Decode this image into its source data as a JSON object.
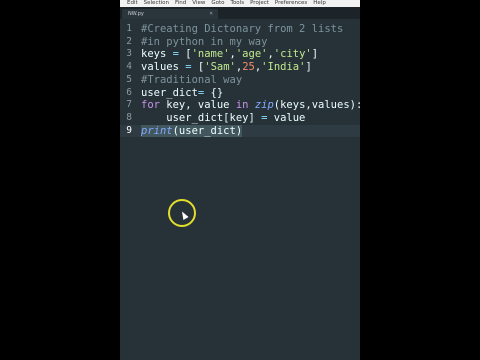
{
  "menubar": {
    "items": [
      "Edit",
      "Selection",
      "Find",
      "View",
      "Goto",
      "Tools",
      "Project",
      "Preferences",
      "Help"
    ]
  },
  "tab": {
    "label": "NW.py",
    "close": "×"
  },
  "editor": {
    "line_numbers": [
      "1",
      "2",
      "3",
      "4",
      "5",
      "6",
      "7",
      "8",
      "9"
    ],
    "lines": [
      [
        {
          "t": "#Creating Dictonary from 2 lists",
          "c": "cm"
        }
      ],
      [
        {
          "t": "#in python in my way",
          "c": "cm"
        }
      ],
      [
        {
          "t": "keys ",
          "c": ""
        },
        {
          "t": "=",
          "c": "op"
        },
        {
          "t": " [",
          "c": ""
        },
        {
          "t": "'name'",
          "c": "str"
        },
        {
          "t": ",",
          "c": ""
        },
        {
          "t": "'age'",
          "c": "str"
        },
        {
          "t": ",",
          "c": ""
        },
        {
          "t": "'city'",
          "c": "str"
        },
        {
          "t": "]",
          "c": ""
        }
      ],
      [
        {
          "t": "values ",
          "c": ""
        },
        {
          "t": "=",
          "c": "op"
        },
        {
          "t": " [",
          "c": ""
        },
        {
          "t": "'Sam'",
          "c": "str"
        },
        {
          "t": ",",
          "c": ""
        },
        {
          "t": "25",
          "c": "num"
        },
        {
          "t": ",",
          "c": ""
        },
        {
          "t": "'India'",
          "c": "str"
        },
        {
          "t": "]",
          "c": ""
        }
      ],
      [
        {
          "t": "#Traditional way",
          "c": "cm"
        }
      ],
      [
        {
          "t": "user_dict",
          "c": ""
        },
        {
          "t": "=",
          "c": "op"
        },
        {
          "t": " {}",
          "c": ""
        }
      ],
      [
        {
          "t": "for",
          "c": "kw"
        },
        {
          "t": " key, value ",
          "c": ""
        },
        {
          "t": "in",
          "c": "kw"
        },
        {
          "t": " ",
          "c": ""
        },
        {
          "t": "zip",
          "c": "fn"
        },
        {
          "t": "(keys,values):",
          "c": ""
        }
      ],
      [
        {
          "t": "    user_dict[key] ",
          "c": ""
        },
        {
          "t": "=",
          "c": "op"
        },
        {
          "t": " value",
          "c": ""
        }
      ],
      [
        {
          "t": "print",
          "c": "fn sel"
        },
        {
          "t": "(user_dict)",
          "c": "sel"
        }
      ]
    ],
    "active_line": 9
  }
}
